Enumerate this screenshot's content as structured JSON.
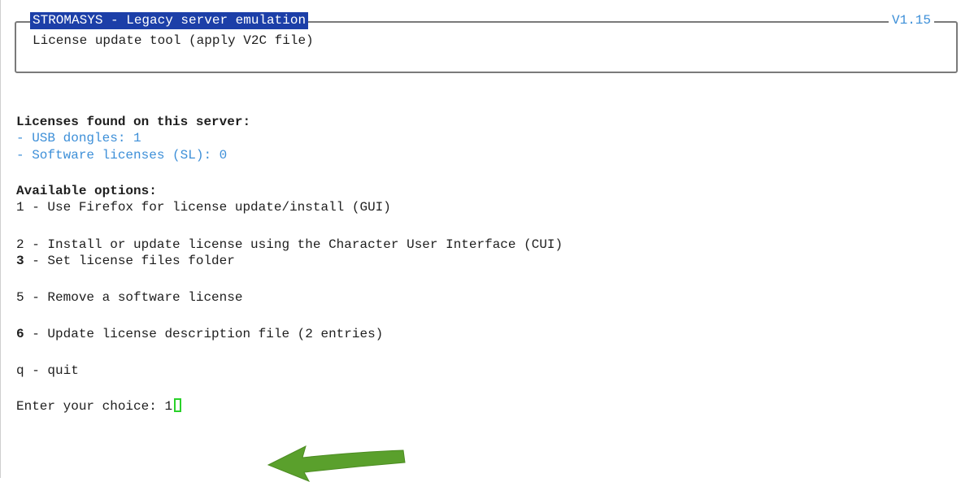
{
  "header": {
    "title": "STROMASYS - Legacy server emulation",
    "version": "V1.15",
    "subtitle": "License update tool (apply V2C file)"
  },
  "licenses": {
    "heading": "Licenses found on this server:",
    "usb": "- USB dongles: 1",
    "sl": "- Software licenses (SL): 0"
  },
  "options": {
    "heading": "Available options:",
    "items": [
      {
        "key": "1",
        "text": " - Use Firefox for license update/install (GUI)"
      },
      {
        "key": "2",
        "text": " - Install or update license using the Character User Interface (CUI)"
      },
      {
        "key": "3",
        "text": " - Set license files folder"
      },
      {
        "key": "5",
        "text": " - Remove a software license"
      },
      {
        "key": "6",
        "text": " - Update license description file (2 entries)"
      },
      {
        "key": "q",
        "text": " - quit"
      }
    ]
  },
  "prompt": {
    "label": "Enter your choice: ",
    "value": "1"
  },
  "colors": {
    "title_bg": "#1c3fa8",
    "accent_blue": "#3d8fd8",
    "cursor_green": "#2ad12a",
    "arrow_green": "#5aa02c"
  },
  "icons": {
    "annotation": "arrow-left-icon"
  }
}
